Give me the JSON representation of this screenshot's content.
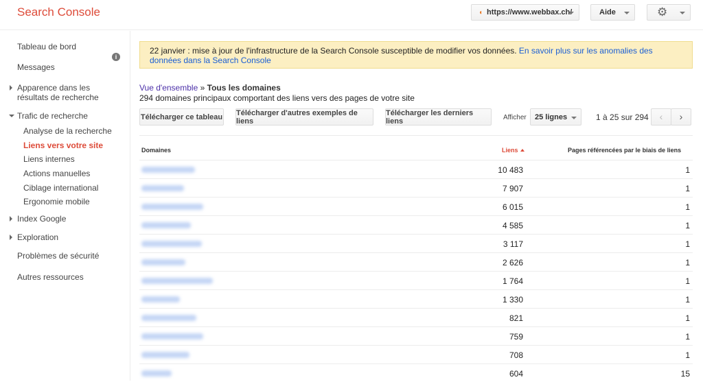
{
  "header": {
    "brand": "Search Console",
    "site": "https://www.webbax.ch/",
    "help": "Aide"
  },
  "sidebar": {
    "dashboard": "Tableau de bord",
    "messages": "Messages",
    "appearance": "Apparence dans les résultats de recherche",
    "traffic": "Trafic de recherche",
    "traffic_items": [
      "Analyse de la recherche",
      "Liens vers votre site",
      "Liens internes",
      "Actions manuelles",
      "Ciblage international",
      "Ergonomie mobile"
    ],
    "index": "Index Google",
    "crawl": "Exploration",
    "security": "Problèmes de sécurité",
    "other": "Autres ressources"
  },
  "banner": {
    "text": "22 janvier : mise à jour de l'infrastructure de la Search Console susceptible de modifier vos données.",
    "link": "En savoir plus sur les anomalies des données dans la Search Console"
  },
  "breadcrumb": {
    "link": "Vue d'ensemble",
    "separator": "»",
    "current": "Tous les domaines"
  },
  "subtitle": "294 domaines principaux comportant des liens vers des pages de votre site",
  "toolbar": {
    "download_table": "Télécharger ce tableau",
    "download_samples": "Télécharger d'autres exemples de liens",
    "download_latest": "Télécharger les derniers liens",
    "show_label": "Afficher",
    "rows_value": "25 lignes",
    "pager": "1 à 25 sur 294",
    "prev": "‹",
    "next": "›"
  },
  "table": {
    "headers": {
      "domains": "Domaines",
      "links": "Liens",
      "pages": "Pages référencées par le biais de liens"
    },
    "rows": [
      {
        "links": "10 483",
        "pages": "1"
      },
      {
        "links": "7 907",
        "pages": "1"
      },
      {
        "links": "6 015",
        "pages": "1"
      },
      {
        "links": "4 585",
        "pages": "1"
      },
      {
        "links": "3 117",
        "pages": "1"
      },
      {
        "links": "2 626",
        "pages": "1"
      },
      {
        "links": "1 764",
        "pages": "1"
      },
      {
        "links": "1 330",
        "pages": "1"
      },
      {
        "links": "821",
        "pages": "1"
      },
      {
        "links": "759",
        "pages": "1"
      },
      {
        "links": "708",
        "pages": "1"
      },
      {
        "links": "604",
        "pages": "15"
      }
    ]
  },
  "colors": {
    "brand": "#dd4b39",
    "banner_bg": "#fcefc2",
    "link": "#1a5ed4"
  }
}
